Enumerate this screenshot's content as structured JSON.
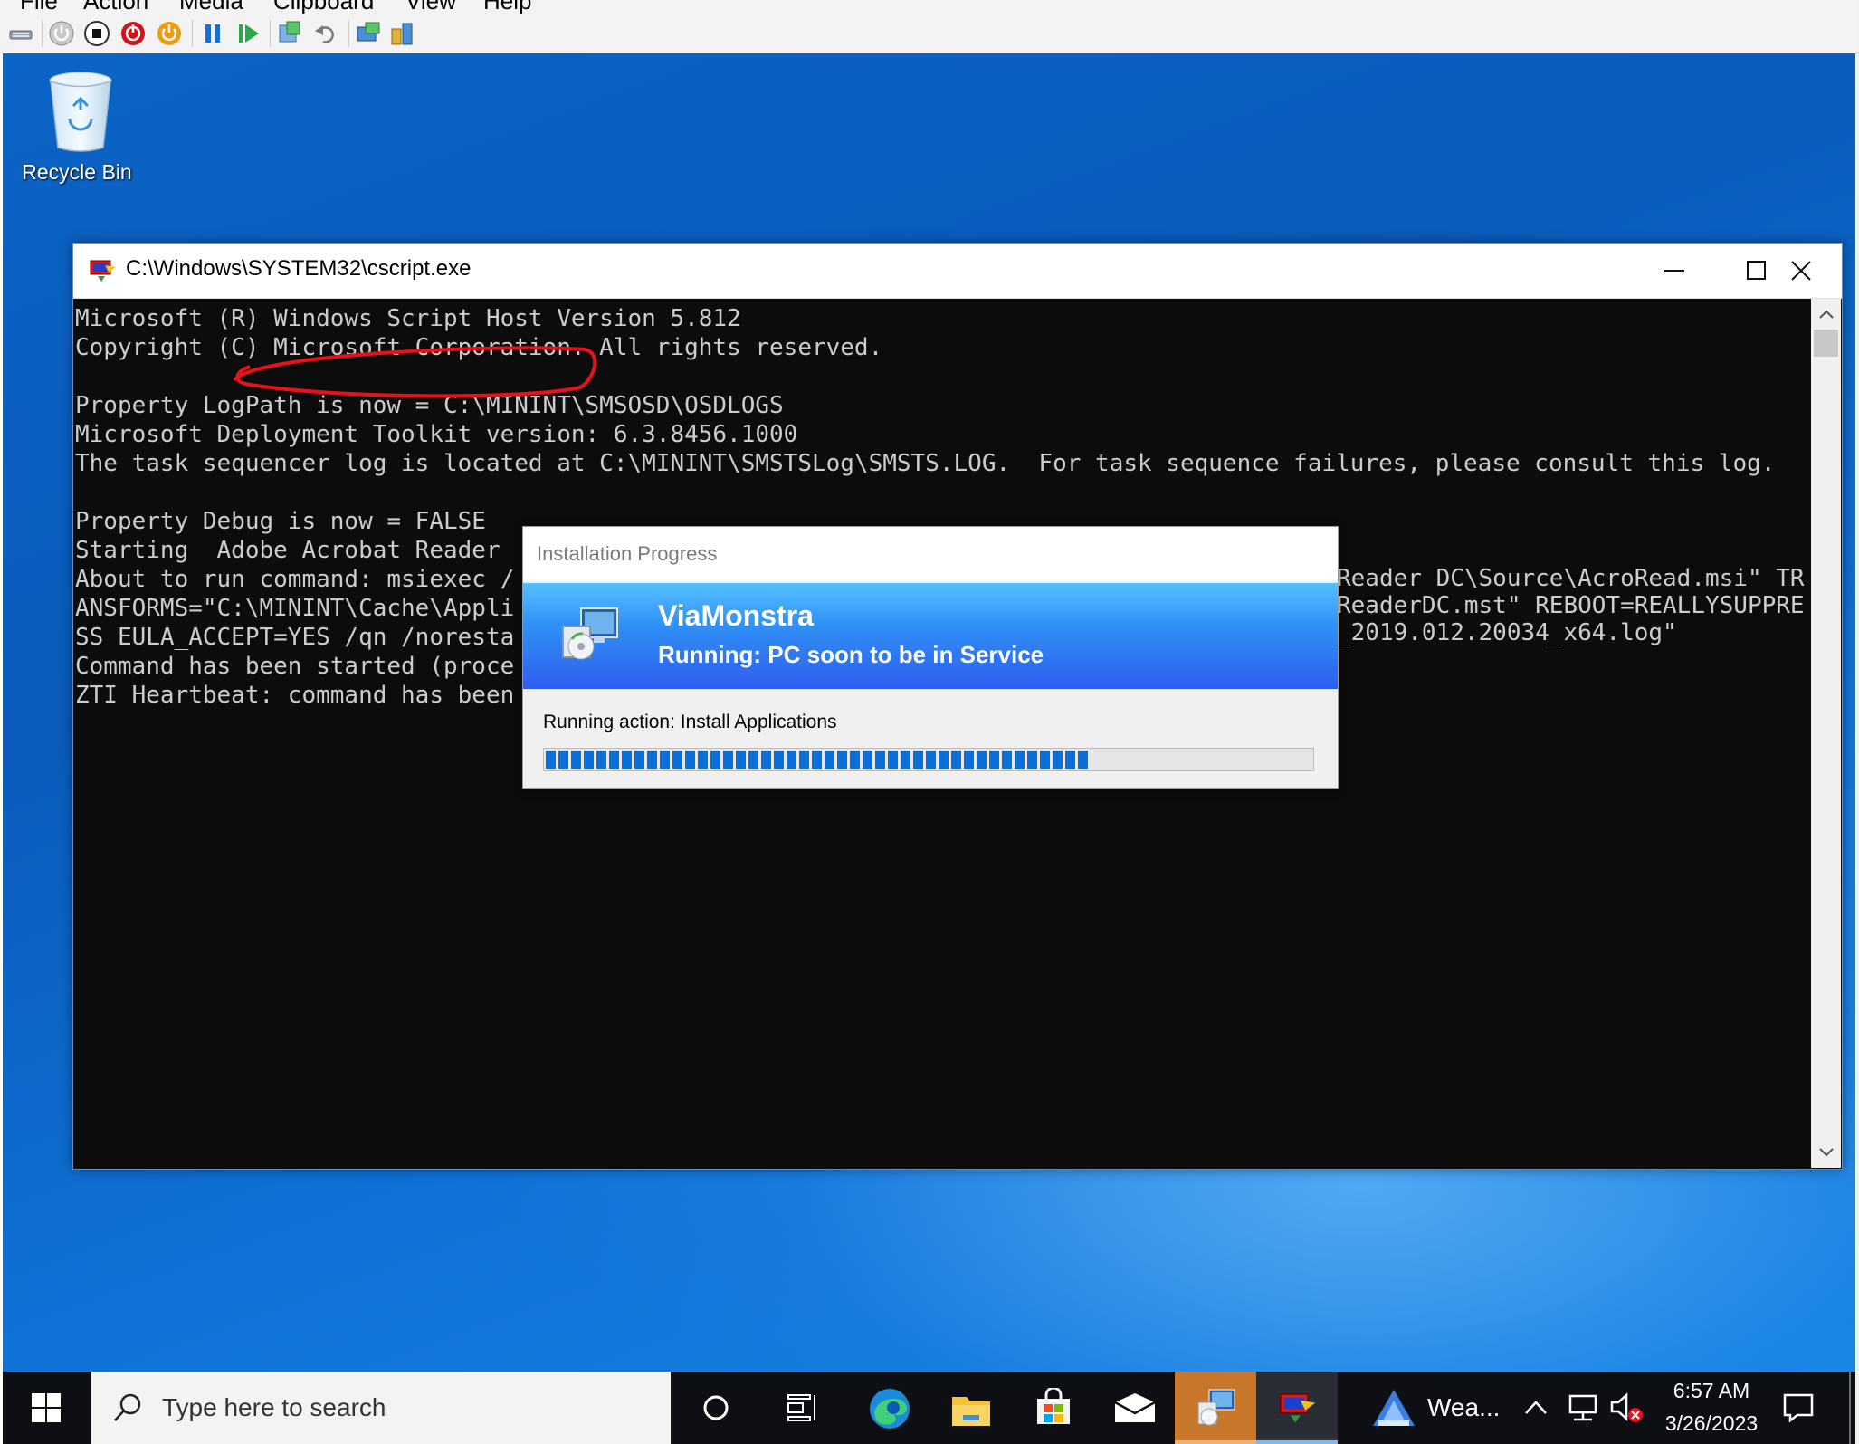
{
  "menubar": {
    "items": [
      "File",
      "Action",
      "Media",
      "Clipboard",
      "View",
      "Help"
    ]
  },
  "toolbar": {
    "icons": [
      "ctrl-alt-del-icon",
      "start-icon",
      "turn-off-icon",
      "shut-down-icon",
      "save-icon",
      "pause-icon",
      "resume-icon",
      "checkpoint-icon",
      "revert-icon",
      "enhanced-session-icon",
      "share-icon"
    ]
  },
  "desktop": {
    "recycle_bin_label": "Recycle Bin"
  },
  "console": {
    "title": "C:\\Windows\\SYSTEM32\\cscript.exe",
    "lines": [
      "Microsoft (R) Windows Script Host Version 5.812",
      "Copyright (C) Microsoft Corporation. All rights reserved.",
      "",
      "Property LogPath is now = C:\\MININT\\SMSOSD\\OSDLOGS",
      "Microsoft Deployment Toolkit version: 6.3.8456.1000",
      "The task sequencer log is located at C:\\MININT\\SMSTSLog\\SMSTS.LOG.  For task sequence failures, please consult this log.",
      "",
      "Property Debug is now = FALSE",
      "Starting  Adobe Acrobat Reader",
      "About to run command: msiexec /",
      "ANSFORMS=\"C:\\MININT\\Cache\\Appli",
      "SS EULA_ACCEPT=YES /qn /noresta",
      "Command has been started (proce",
      "ZTI Heartbeat: command has been"
    ],
    "lines_right": [
      "Reader DC\\Source\\AcroRead.msi\" TR",
      "ReaderDC.mst\" REBOOT=REALLYSUPPRE",
      "_2019.012.20034_x64.log\""
    ]
  },
  "dialog": {
    "title": "Installation Progress",
    "org_name": "ViaMonstra",
    "task_sequence": "Running: PC soon to be in Service",
    "action": "Running action: Install Applications",
    "progress_fraction": 0.71
  },
  "taskbar": {
    "search_placeholder": "Type here to search",
    "weather": "Wea...",
    "time": "6:57 AM",
    "date": "3/26/2023"
  },
  "colors": {
    "desktop_blue": "#0b64c6",
    "console_bg": "#0c0c0c",
    "console_text": "#cccccc",
    "annotation_red": "#e8101a",
    "progress_blue": "#0a6fd8",
    "banner_blue": "#2f7ff0"
  }
}
